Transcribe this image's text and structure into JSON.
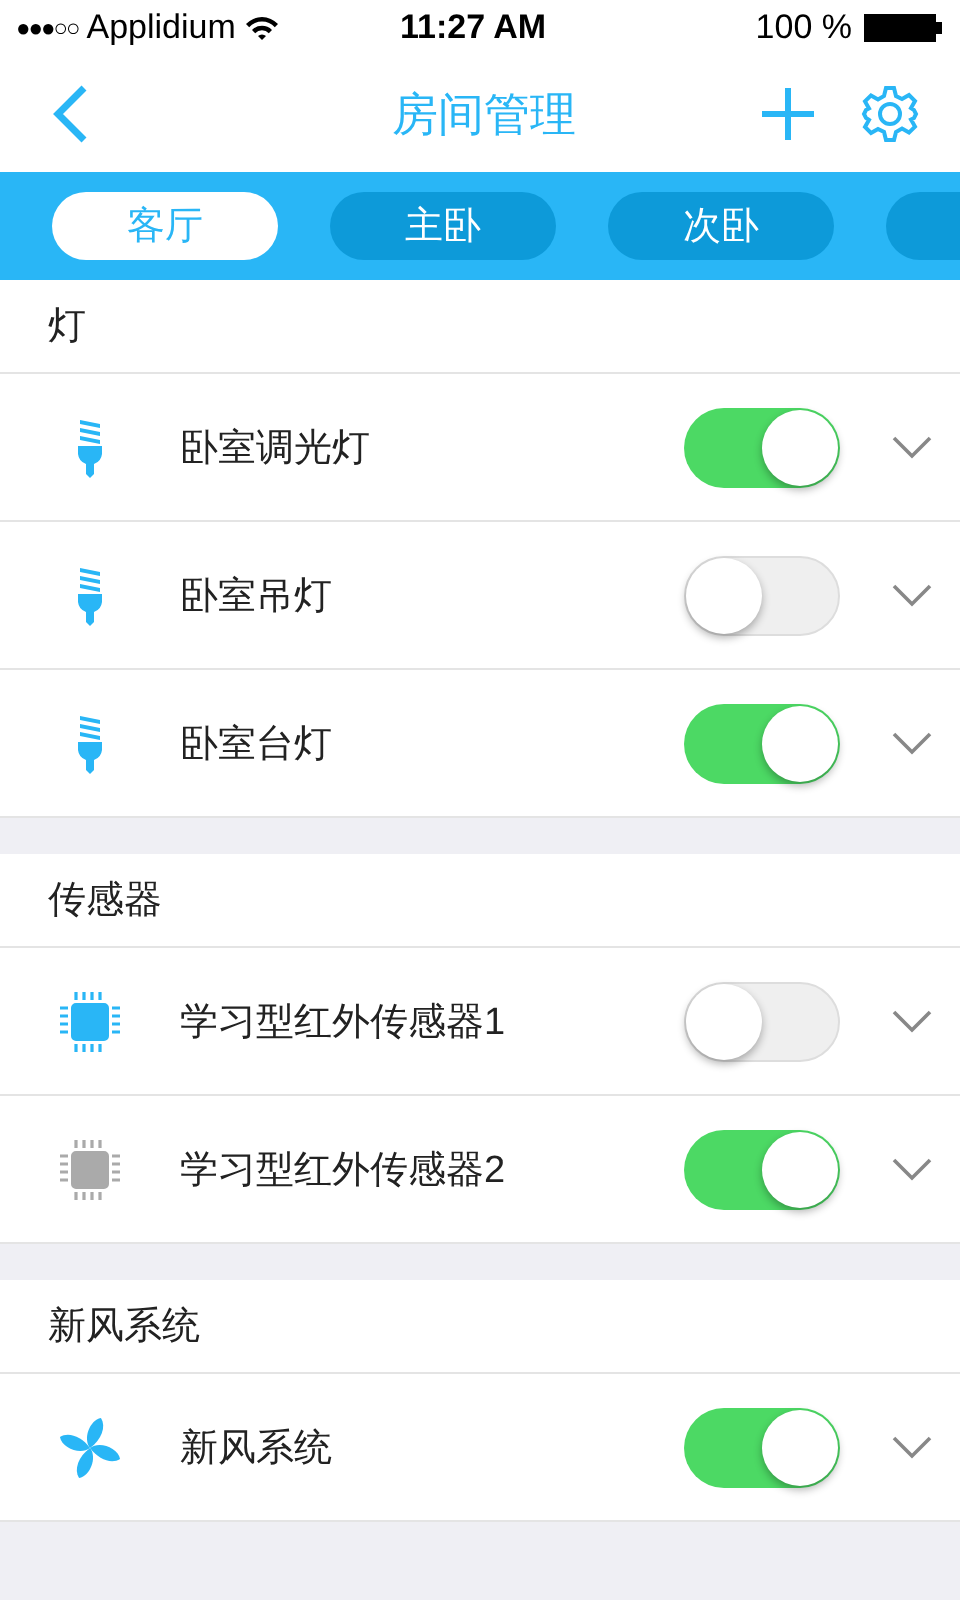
{
  "status_bar": {
    "signal": "●●●○○",
    "carrier": "Applidium",
    "time": "11:27 AM",
    "battery": "100 %"
  },
  "nav": {
    "title": "房间管理"
  },
  "tabs": [
    {
      "label": "客厅",
      "selected": true
    },
    {
      "label": "主卧",
      "selected": false
    },
    {
      "label": "次卧",
      "selected": false
    }
  ],
  "sections": [
    {
      "title": "灯",
      "devices": [
        {
          "kind": "bulb",
          "name": "卧室调光灯",
          "on": true,
          "online": true
        },
        {
          "kind": "bulb",
          "name": "卧室吊灯",
          "on": false,
          "online": true
        },
        {
          "kind": "bulb",
          "name": "卧室台灯",
          "on": true,
          "online": true
        }
      ]
    },
    {
      "title": "传感器",
      "devices": [
        {
          "kind": "chip",
          "name": "学习型红外传感器1",
          "on": false,
          "online": true
        },
        {
          "kind": "chip",
          "name": "学习型红外传感器2",
          "on": true,
          "online": false
        }
      ]
    },
    {
      "title": "新风系统",
      "devices": [
        {
          "kind": "fan",
          "name": "新风系统",
          "on": true,
          "online": true
        }
      ]
    }
  ]
}
